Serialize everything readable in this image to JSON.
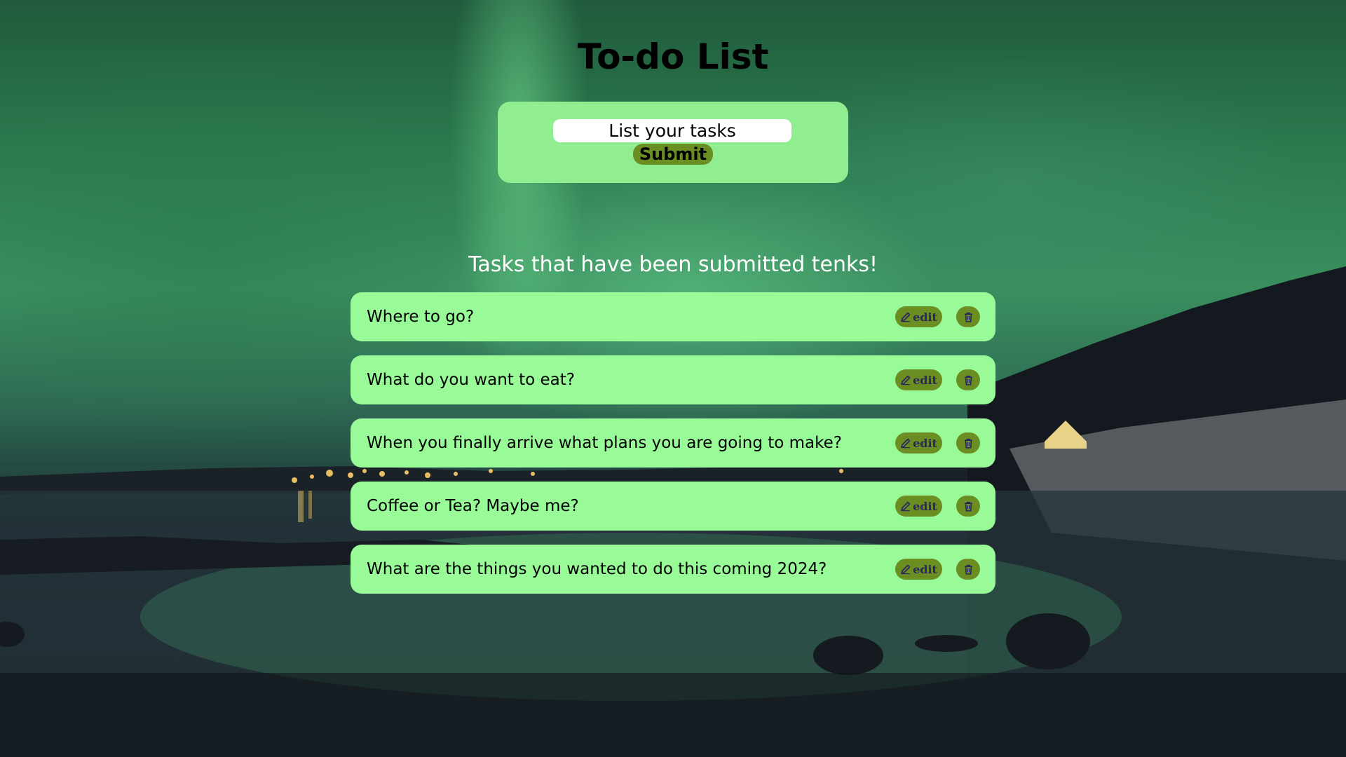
{
  "page": {
    "title": "To-do List"
  },
  "form": {
    "input_placeholder": "List your tasks",
    "input_value": "",
    "submit_label": "Submit"
  },
  "list": {
    "heading": "Tasks that have been submitted tenks!",
    "edit_label": "edit",
    "tasks": [
      {
        "text": "Where to go?"
      },
      {
        "text": "What do you want to eat?"
      },
      {
        "text": "When you finally arrive what plans you are going to make?"
      },
      {
        "text": "Coffee or Tea? Maybe me?"
      },
      {
        "text": "What are the things you wanted to do this coming 2024?"
      }
    ]
  },
  "icons": {
    "edit": "pencil-icon",
    "delete": "trash-icon"
  },
  "colors": {
    "form_card": "#90ee90",
    "task_item": "#98fb98",
    "button": "#6b8e23",
    "edit_text": "#2b2560",
    "heading_text": "#ffffff"
  }
}
